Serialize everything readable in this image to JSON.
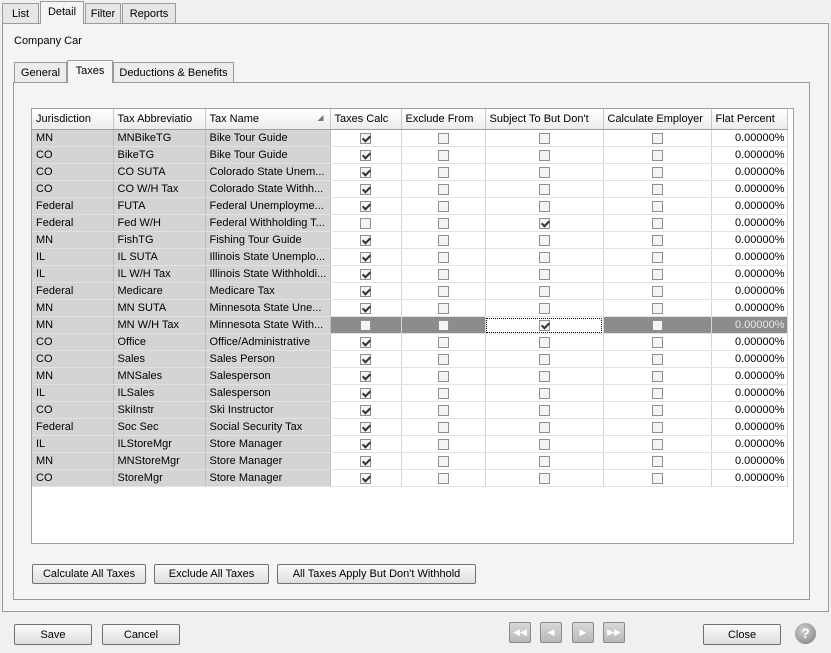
{
  "top_tabs": [
    "List",
    "Detail",
    "Filter",
    "Reports"
  ],
  "record_title": "Company Car",
  "sub_tabs": [
    "General",
    "Taxes",
    "Deductions & Benefits"
  ],
  "columns": [
    "Jurisdiction",
    "Tax Abbreviatio",
    "Tax Name",
    "Taxes Calc",
    "Exclude From",
    "Subject To But Don't",
    "Calculate Employer",
    "Flat Percent"
  ],
  "rows": [
    {
      "jurisdiction": "MN",
      "abbr": "MNBikeTG",
      "name": "Bike Tour Guide",
      "taxes_calc": true,
      "exclude": false,
      "subject": false,
      "employer": false,
      "flat": "0.00000%"
    },
    {
      "jurisdiction": "CO",
      "abbr": "BikeTG",
      "name": "Bike Tour Guide",
      "taxes_calc": true,
      "exclude": false,
      "subject": false,
      "employer": false,
      "flat": "0.00000%"
    },
    {
      "jurisdiction": "CO",
      "abbr": "CO SUTA",
      "name": "Colorado State Unem...",
      "taxes_calc": true,
      "exclude": false,
      "subject": false,
      "employer": false,
      "flat": "0.00000%"
    },
    {
      "jurisdiction": "CO",
      "abbr": "CO W/H Tax",
      "name": "Colorado State Withh...",
      "taxes_calc": true,
      "exclude": false,
      "subject": false,
      "employer": false,
      "flat": "0.00000%"
    },
    {
      "jurisdiction": "Federal",
      "abbr": "FUTA",
      "name": "Federal Unemployme...",
      "taxes_calc": true,
      "exclude": false,
      "subject": false,
      "employer": false,
      "flat": "0.00000%"
    },
    {
      "jurisdiction": "Federal",
      "abbr": "Fed W/H",
      "name": "Federal Withholding T...",
      "taxes_calc": false,
      "exclude": false,
      "subject": true,
      "employer": false,
      "flat": "0.00000%"
    },
    {
      "jurisdiction": "MN",
      "abbr": "FishTG",
      "name": "Fishing Tour Guide",
      "taxes_calc": true,
      "exclude": false,
      "subject": false,
      "employer": false,
      "flat": "0.00000%"
    },
    {
      "jurisdiction": "IL",
      "abbr": "IL SUTA",
      "name": "Illinois State Unemplo...",
      "taxes_calc": true,
      "exclude": false,
      "subject": false,
      "employer": false,
      "flat": "0.00000%"
    },
    {
      "jurisdiction": "IL",
      "abbr": "IL W/H Tax",
      "name": "Illinois State Withholdi...",
      "taxes_calc": true,
      "exclude": false,
      "subject": false,
      "employer": false,
      "flat": "0.00000%"
    },
    {
      "jurisdiction": "Federal",
      "abbr": "Medicare",
      "name": "Medicare Tax",
      "taxes_calc": true,
      "exclude": false,
      "subject": false,
      "employer": false,
      "flat": "0.00000%"
    },
    {
      "jurisdiction": "MN",
      "abbr": "MN SUTA",
      "name": "Minnesota State Une...",
      "taxes_calc": true,
      "exclude": false,
      "subject": false,
      "employer": false,
      "flat": "0.00000%"
    },
    {
      "jurisdiction": "MN",
      "abbr": "MN W/H Tax",
      "name": "Minnesota State With...",
      "taxes_calc": false,
      "exclude": false,
      "subject": true,
      "employer": false,
      "flat": "0.00000%",
      "selected": true
    },
    {
      "jurisdiction": "CO",
      "abbr": "Office",
      "name": "Office/Administrative",
      "taxes_calc": true,
      "exclude": false,
      "subject": false,
      "employer": false,
      "flat": "0.00000%"
    },
    {
      "jurisdiction": "CO",
      "abbr": "Sales",
      "name": "Sales Person",
      "taxes_calc": true,
      "exclude": false,
      "subject": false,
      "employer": false,
      "flat": "0.00000%"
    },
    {
      "jurisdiction": "MN",
      "abbr": "MNSales",
      "name": "Salesperson",
      "taxes_calc": true,
      "exclude": false,
      "subject": false,
      "employer": false,
      "flat": "0.00000%"
    },
    {
      "jurisdiction": "IL",
      "abbr": "ILSales",
      "name": "Salesperson",
      "taxes_calc": true,
      "exclude": false,
      "subject": false,
      "employer": false,
      "flat": "0.00000%"
    },
    {
      "jurisdiction": "CO",
      "abbr": "SkiInstr",
      "name": "Ski Instructor",
      "taxes_calc": true,
      "exclude": false,
      "subject": false,
      "employer": false,
      "flat": "0.00000%"
    },
    {
      "jurisdiction": "Federal",
      "abbr": "Soc Sec",
      "name": "Social Security Tax",
      "taxes_calc": true,
      "exclude": false,
      "subject": false,
      "employer": false,
      "flat": "0.00000%"
    },
    {
      "jurisdiction": "IL",
      "abbr": "ILStoreMgr",
      "name": "Store Manager",
      "taxes_calc": true,
      "exclude": false,
      "subject": false,
      "employer": false,
      "flat": "0.00000%"
    },
    {
      "jurisdiction": "MN",
      "abbr": "MNStoreMgr",
      "name": "Store Manager",
      "taxes_calc": true,
      "exclude": false,
      "subject": false,
      "employer": false,
      "flat": "0.00000%"
    },
    {
      "jurisdiction": "CO",
      "abbr": "StoreMgr",
      "name": "Store Manager",
      "taxes_calc": true,
      "exclude": false,
      "subject": false,
      "employer": false,
      "flat": "0.00000%"
    }
  ],
  "sorted_column": "Tax Name",
  "grid_buttons": {
    "calc_all": "Calculate All Taxes",
    "exclude_all": "Exclude All Taxes",
    "apply_no_withhold": "All Taxes Apply But Don't Withhold"
  },
  "footer": {
    "save": "Save",
    "cancel": "Cancel",
    "close": "Close",
    "help_icon": "question-mark-icon",
    "nav_icons": [
      "first-record-icon",
      "previous-record-icon",
      "next-record-icon",
      "last-record-icon"
    ]
  }
}
